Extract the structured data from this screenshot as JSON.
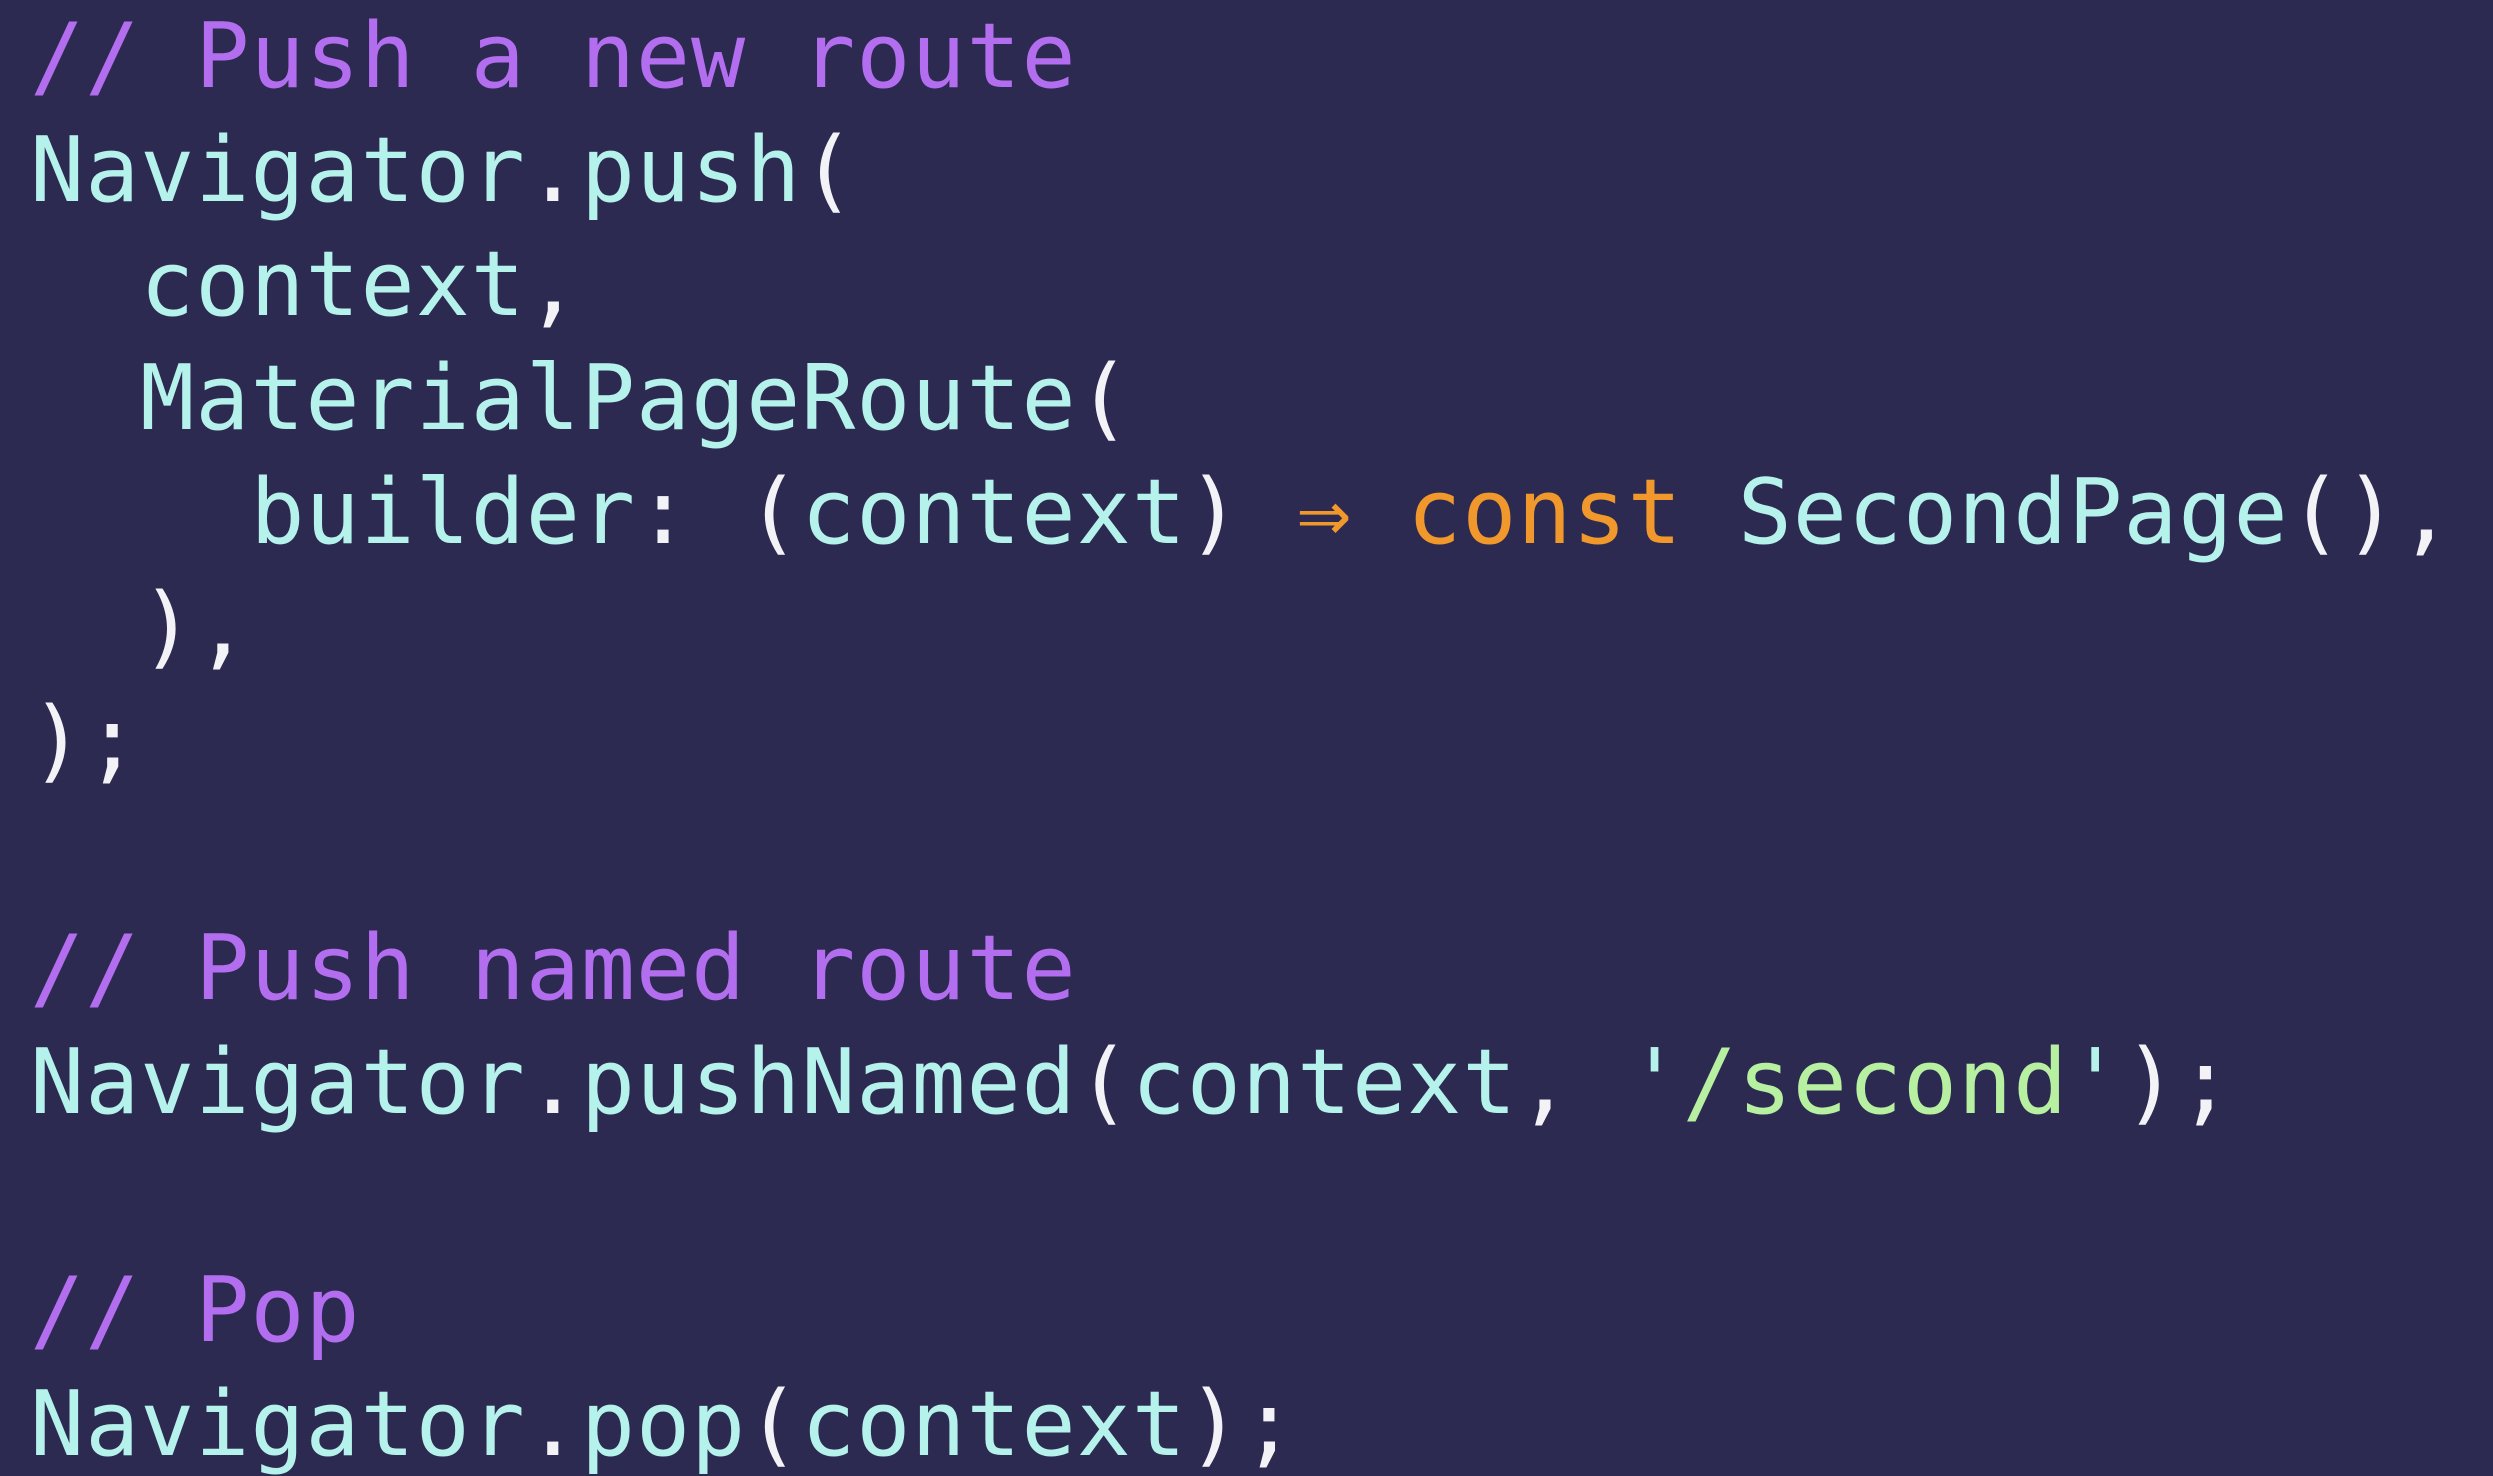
{
  "colors": {
    "background": "#2d2a52",
    "comment": "#b36ef0",
    "identifier": "#b6f2ec",
    "punctuation": "#f3f3f7",
    "keyword": "#f0982c",
    "string": "#b6f0a0"
  },
  "code": {
    "lines": [
      {
        "tokens": [
          {
            "text": "// Push a new route",
            "kind": "comment"
          }
        ]
      },
      {
        "tokens": [
          {
            "text": "Navigator",
            "kind": "ident"
          },
          {
            "text": ".",
            "kind": "punct"
          },
          {
            "text": "push",
            "kind": "ident"
          },
          {
            "text": "(",
            "kind": "punct"
          }
        ]
      },
      {
        "tokens": [
          {
            "text": "  ",
            "kind": "punct"
          },
          {
            "text": "context",
            "kind": "ident"
          },
          {
            "text": ",",
            "kind": "punct"
          }
        ]
      },
      {
        "tokens": [
          {
            "text": "  ",
            "kind": "punct"
          },
          {
            "text": "MaterialPageRoute",
            "kind": "ident"
          },
          {
            "text": "(",
            "kind": "punct"
          }
        ]
      },
      {
        "tokens": [
          {
            "text": "    ",
            "kind": "punct"
          },
          {
            "text": "builder",
            "kind": "ident"
          },
          {
            "text": ": (",
            "kind": "punct"
          },
          {
            "text": "context",
            "kind": "ident"
          },
          {
            "text": ") ",
            "kind": "punct"
          },
          {
            "text": "⇒",
            "kind": "arrow"
          },
          {
            "text": " ",
            "kind": "punct"
          },
          {
            "text": "const",
            "kind": "keyword"
          },
          {
            "text": " ",
            "kind": "punct"
          },
          {
            "text": "SecondPage",
            "kind": "ident"
          },
          {
            "text": "(),",
            "kind": "punct"
          }
        ]
      },
      {
        "tokens": [
          {
            "text": "  ),",
            "kind": "punct"
          }
        ]
      },
      {
        "tokens": [
          {
            "text": ");",
            "kind": "punct"
          }
        ]
      },
      {
        "tokens": []
      },
      {
        "tokens": [
          {
            "text": "// Push named route",
            "kind": "comment"
          }
        ]
      },
      {
        "tokens": [
          {
            "text": "Navigator",
            "kind": "ident"
          },
          {
            "text": ".",
            "kind": "punct"
          },
          {
            "text": "pushNamed",
            "kind": "ident"
          },
          {
            "text": "(",
            "kind": "punct"
          },
          {
            "text": "context",
            "kind": "ident"
          },
          {
            "text": ", ",
            "kind": "punct"
          },
          {
            "text": "'",
            "kind": "quote"
          },
          {
            "text": "/second",
            "kind": "string"
          },
          {
            "text": "'",
            "kind": "quote"
          },
          {
            "text": ");",
            "kind": "punct"
          }
        ]
      },
      {
        "tokens": []
      },
      {
        "tokens": [
          {
            "text": "// Pop",
            "kind": "comment"
          }
        ]
      },
      {
        "tokens": [
          {
            "text": "Navigator",
            "kind": "ident"
          },
          {
            "text": ".",
            "kind": "punct"
          },
          {
            "text": "pop",
            "kind": "ident"
          },
          {
            "text": "(",
            "kind": "punct"
          },
          {
            "text": "context",
            "kind": "ident"
          },
          {
            "text": ");",
            "kind": "punct"
          }
        ]
      }
    ]
  }
}
